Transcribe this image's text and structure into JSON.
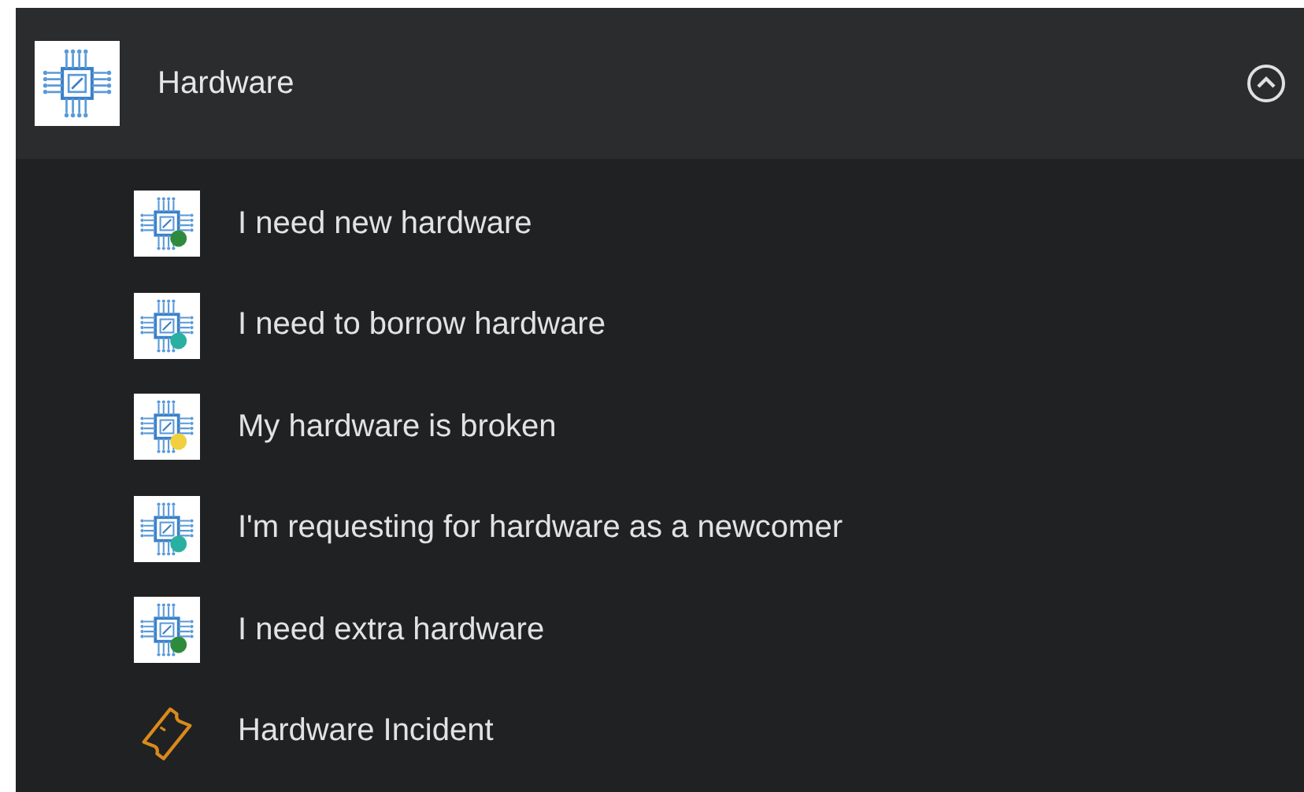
{
  "category": {
    "title": "Hardware",
    "expanded": true
  },
  "items": [
    {
      "label": "I need new hardware",
      "kind": "chip",
      "color": "#2e8b3e"
    },
    {
      "label": "I need to borrow hardware",
      "kind": "chip",
      "color": "#2ab0a0"
    },
    {
      "label": "My hardware is broken",
      "kind": "chip",
      "color": "#f0d040"
    },
    {
      "label": "I'm requesting for hardware as a newcomer",
      "kind": "chip",
      "color": "#2ab0a0"
    },
    {
      "label": "I need extra hardware",
      "kind": "chip",
      "color": "#2e8b3e"
    },
    {
      "label": "Hardware Incident",
      "kind": "ticket"
    }
  ]
}
